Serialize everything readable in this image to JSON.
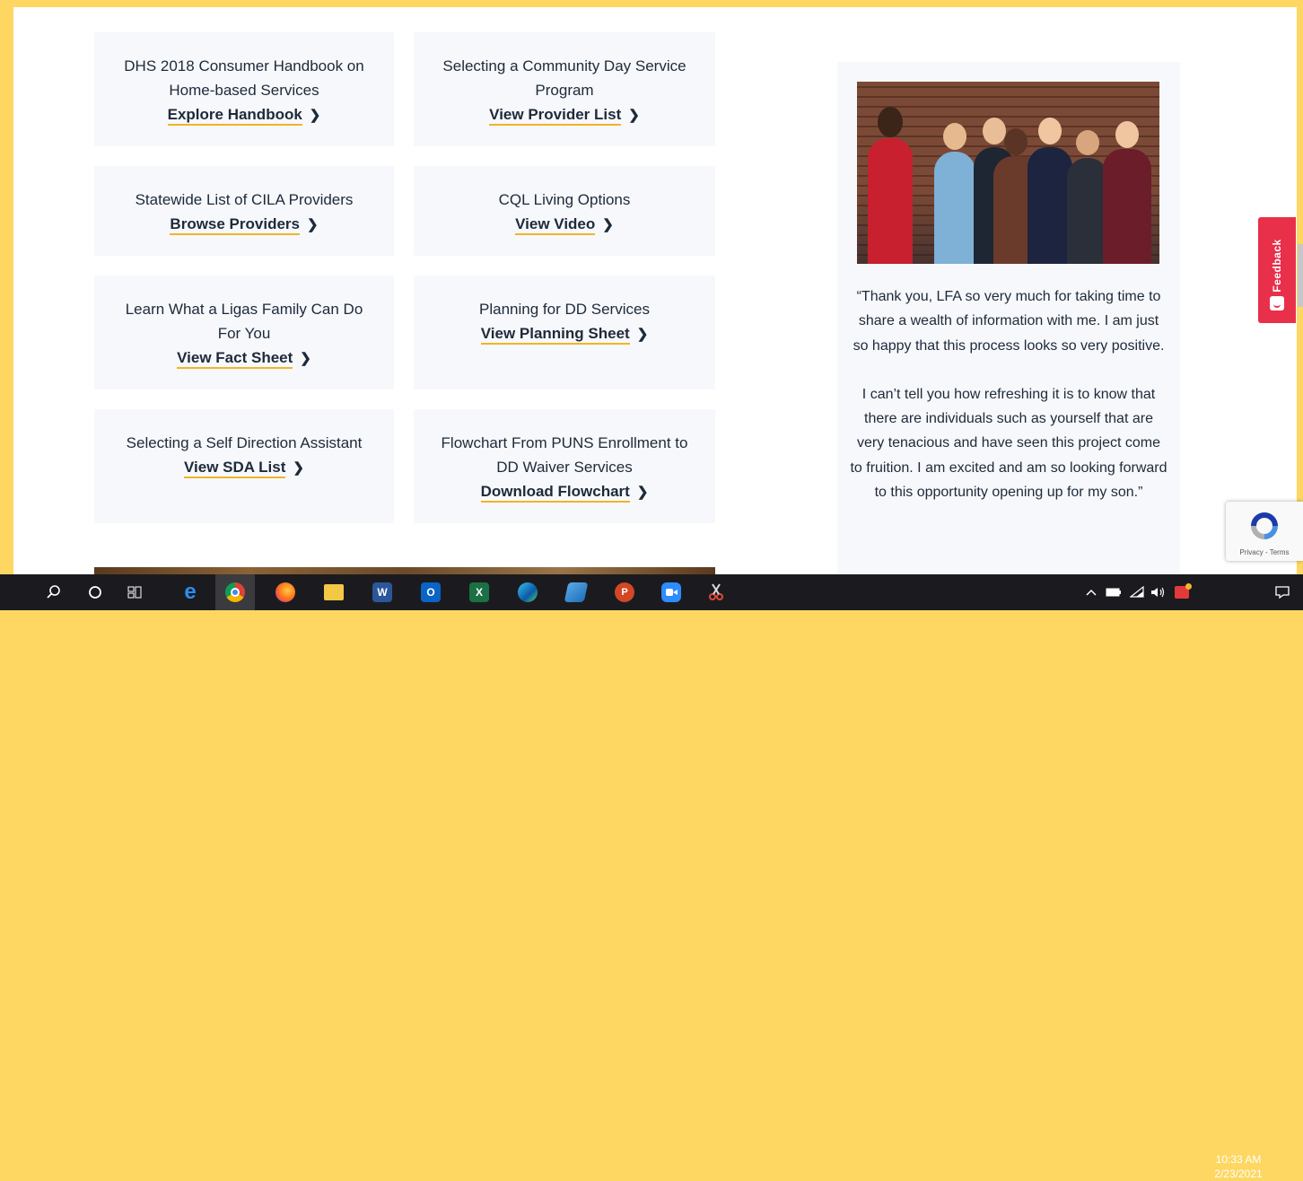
{
  "cards": [
    {
      "title": "DHS 2018 Consumer Handbook on Home-based Services",
      "link": "Explore Handbook"
    },
    {
      "title": "Selecting a Community Day Service Program",
      "link": "View Provider List"
    },
    {
      "title": "Statewide List of CILA Providers",
      "link": "Browse Providers"
    },
    {
      "title": "CQL Living Options",
      "link": "View Video"
    },
    {
      "title": "Learn What a Ligas Family Can Do For You",
      "link": "View Fact Sheet"
    },
    {
      "title": "Planning for DD Services",
      "link": "View Planning Sheet"
    },
    {
      "title": "Selecting a Self Direction Assistant",
      "link": "View SDA List"
    },
    {
      "title": "Flowchart From PUNS Enrollment to DD Waiver Services",
      "link": "Download Flowchart"
    }
  ],
  "testimonial": {
    "quote_p1": "“Thank you, LFA so very much for taking time to share a wealth of information with me. I am just so happy that this process looks so very positive.",
    "quote_p2": "I can’t tell you how refreshing it is to know that there are individuals such as yourself that are very tenacious and have seen this project come to fruition. I am excited and am so looking forward to this opportunity opening up for my son.”"
  },
  "feedback": {
    "label": "Feedback"
  },
  "recaptcha": {
    "text": "Privacy - Terms"
  },
  "taskbar": {
    "apps": [
      "search-icon",
      "cortana-icon",
      "task-view-icon",
      "internet-explorer-icon",
      "chrome-icon",
      "firefox-icon",
      "file-explorer-icon",
      "word-icon",
      "outlook-icon",
      "excel-icon",
      "edge-icon",
      "app-icon",
      "powerpoint-icon",
      "zoom-icon",
      "snipping-tool-icon"
    ],
    "time": "10:33 AM",
    "date": "2/23/2021"
  },
  "colors": {
    "accent_underline": "#f0b429",
    "card_bg": "#f7f8fb",
    "frame": "#fdd762",
    "feedback": "#e8304a"
  }
}
